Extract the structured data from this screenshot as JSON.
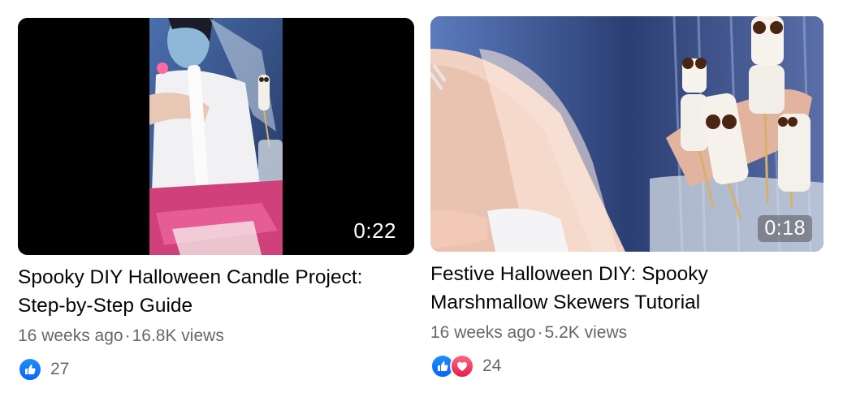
{
  "videos": [
    {
      "duration": "0:22",
      "title_line1": "Spooky DIY Halloween Candle Project:",
      "title_line2": "Step-by-Step Guide",
      "age": "16 weeks ago",
      "views": "16.8K views",
      "reaction_count": "27",
      "reactions": [
        "like-icon"
      ]
    },
    {
      "duration": "0:18",
      "title_line1": "Festive Halloween DIY: Spooky",
      "title_line2": "Marshmallow Skewers Tutorial",
      "age": "16 weeks ago",
      "views": "5.2K views",
      "reaction_count": "24",
      "reactions": [
        "like-icon",
        "love-icon"
      ]
    }
  ],
  "colors": {
    "like": "#0866ff",
    "love": "#e61e4d",
    "secondary_text": "#65676b"
  }
}
